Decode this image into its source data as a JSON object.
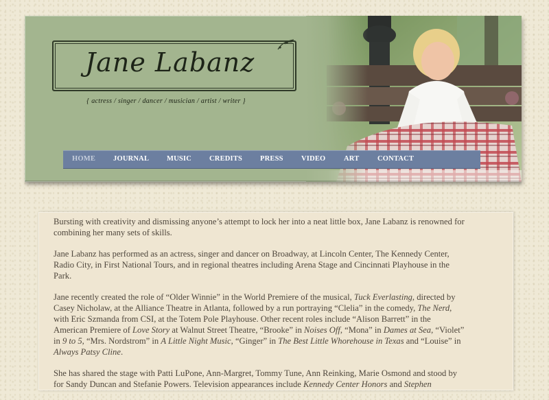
{
  "site": {
    "logo_text": "Jane Labanz",
    "tagline": "{ actress / singer / dancer / musician / artist / writer }"
  },
  "nav": {
    "items": [
      {
        "label": "HOME",
        "active": true
      },
      {
        "label": "JOURNAL",
        "active": false
      },
      {
        "label": "MUSIC",
        "active": false
      },
      {
        "label": "CREDITS",
        "active": false
      },
      {
        "label": "PRESS",
        "active": false
      },
      {
        "label": "VIDEO",
        "active": false
      },
      {
        "label": "ART",
        "active": false
      },
      {
        "label": "CONTACT",
        "active": false
      }
    ]
  },
  "content": {
    "p1": "Bursting with creativity and dismissing anyone’s attempt to lock her into a neat little box, Jane Labanz is renowned for combining her many sets of skills.",
    "p2": "Jane Labanz has performed as an actress, singer and dancer on Broadway, at Lincoln Center, The Kennedy Center, Radio City, in First National Tours, and in regional theatres including Arena Stage and Cincinnati Playhouse in the Park.",
    "p3": {
      "s1": "Jane recently created the role of “Older Winnie” in the World Premiere of the musical, ",
      "t1": "Tuck Everlasting",
      "s2": ", directed by Casey Nicholaw, at the Alliance Theatre in Atlanta, followed by a run portraying “Clelia” in the comedy, ",
      "t2": "The Nerd",
      "s3": ", with Eric Szmanda from CSI, at the Totem Pole Playhouse. Other recent roles include  “Alison Barrett” in the American Premiere of ",
      "t3": "Love Story",
      "s4": " at Walnut Street Theatre, “Brooke” in ",
      "t4": "Noises Off",
      "s5": ", “Mona” in ",
      "t5": "Dames at Sea",
      "s6": ", “Violet” in ",
      "t6": "9 to 5",
      "s7": ", “Mrs. Nordstrom” in ",
      "t7": "A Little Night Music",
      "s8": ", “Ginger” in ",
      "t8": "The Best Little Whorehouse in Texas",
      "s9": " and “Louise” in ",
      "t9": "Always Patsy Cline",
      "s10": "."
    },
    "p4": {
      "s1": "She has shared the stage with Patti LuPone, Ann-Margret, Tommy Tune, Ann Reinking, Marie Osmond and stood by for Sandy Duncan and Stefanie Powers.  Television appearances include ",
      "t1": "Kennedy Center Honors",
      "s2": " and ",
      "t2": "Stephen"
    }
  },
  "colors": {
    "header_green": "#a3b58f",
    "nav_blue": "#6c7fa0",
    "panel_cream": "#efe6d2",
    "text_brown": "#4e463c"
  }
}
